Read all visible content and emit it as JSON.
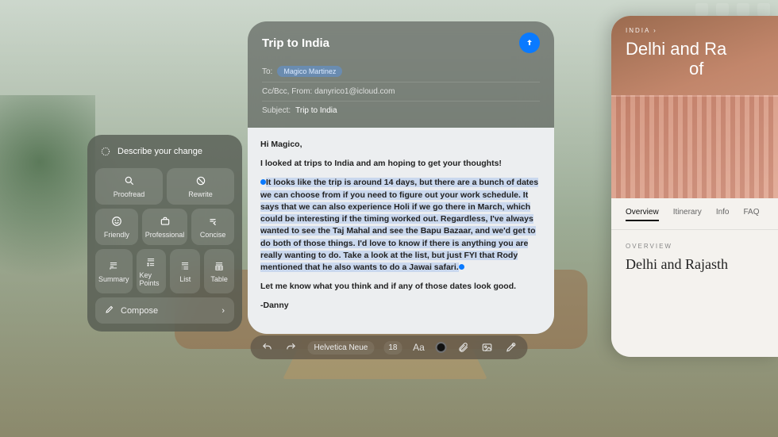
{
  "writing_tools": {
    "header": "Describe your change",
    "buttons": {
      "proofread": "Proofread",
      "rewrite": "Rewrite",
      "friendly": "Friendly",
      "professional": "Professional",
      "concise": "Concise",
      "summary": "Summary",
      "keypoints": "Key Points",
      "list": "List",
      "table": "Table"
    },
    "compose": "Compose"
  },
  "mail": {
    "title": "Trip to India",
    "to_label": "To:",
    "to_chip": "Magico Martinez",
    "ccbcc": "Cc/Bcc, From: danyrico1@icloud.com",
    "subject_label": "Subject:",
    "subject_value": "Trip to India",
    "body": {
      "greeting": "Hi Magico,",
      "intro": "I looked at trips to India and am hoping to get your thoughts!",
      "highlighted": "It looks like the trip is around 14 days, but there are a bunch of dates we can choose from if you need to figure out your work schedule. It says that we can also experience Holi if we go there in March, which could be interesting if the timing worked out. Regardless, I've always wanted to see the Taj Mahal and see the Bapu Bazaar, and we'd get to do both of those things.  I'd love to know if there is anything you are really wanting to do. Take a look at the list, but just FYI that Rody mentioned that he also wants to do a Jawai safari.",
      "closing": "Let me know what you think and if any of those dates look good.",
      "signature": "-Danny"
    },
    "toolbar": {
      "font": "Helvetica Neue",
      "size": "18",
      "aa": "Aa"
    }
  },
  "content": {
    "crumb": "INDIA",
    "hero_title": "Delhi and Ra",
    "hero_title2": "of",
    "tabs": {
      "overview": "Overview",
      "itinerary": "Itinerary",
      "info": "Info",
      "faq": "FAQ"
    },
    "section_label": "OVERVIEW",
    "headline": "Delhi and Rajasth"
  }
}
